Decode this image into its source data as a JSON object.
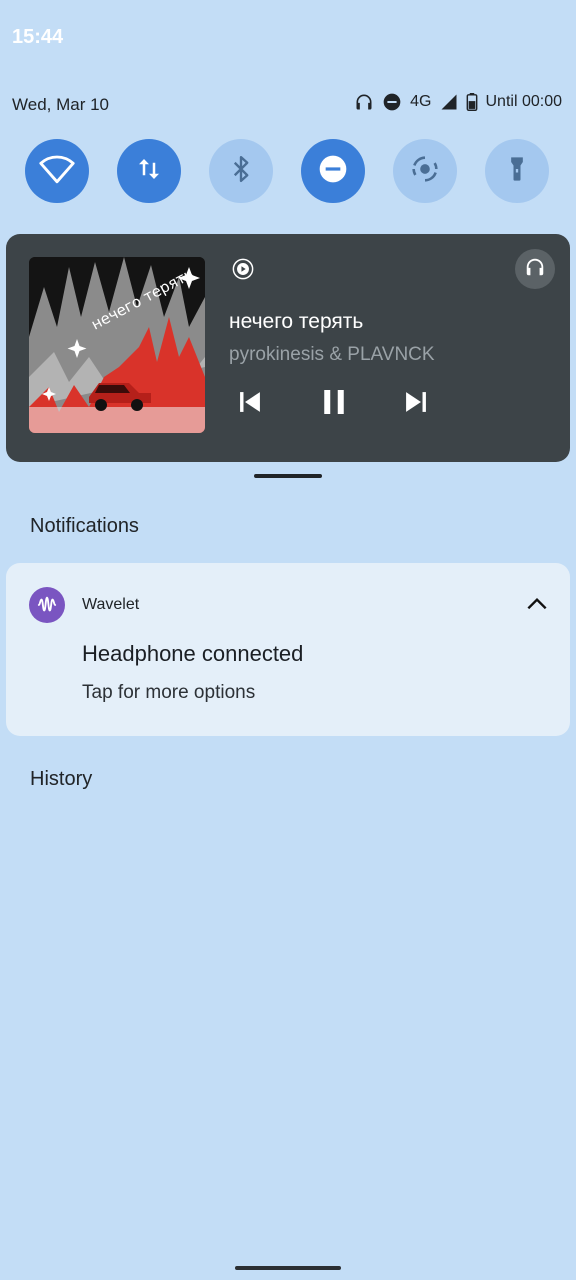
{
  "status_bar": {
    "time": "15:44",
    "date": "Wed, Mar 10",
    "network": "4G",
    "battery_text": "Until 00:00",
    "icons": [
      "headphones-icon",
      "do-not-disturb-icon",
      "signal-icon",
      "battery-icon"
    ]
  },
  "quick_settings": [
    {
      "name": "wifi",
      "icon": "wifi-icon",
      "state": "on"
    },
    {
      "name": "mobile-data",
      "icon": "data-transfer-icon",
      "state": "on"
    },
    {
      "name": "bluetooth",
      "icon": "bluetooth-icon",
      "state": "off"
    },
    {
      "name": "do-not-disturb",
      "icon": "do-not-disturb-icon",
      "state": "on"
    },
    {
      "name": "auto-rotate",
      "icon": "auto-rotate-icon",
      "state": "off"
    },
    {
      "name": "flashlight",
      "icon": "flashlight-icon",
      "state": "off"
    }
  ],
  "media": {
    "title": "нечего терять",
    "artist": "pyrokinesis & PLAVNCK",
    "album_art_text": "нечего терять",
    "colors": {
      "card": "#3d4448",
      "art_red": "#d9332a"
    }
  },
  "notifications": {
    "header": "Notifications",
    "items": [
      {
        "app": "Wavelet",
        "title": "Headphone connected",
        "text": "Tap for more options",
        "icon_color": "#7a55c1"
      }
    ]
  },
  "history": {
    "label": "History"
  },
  "colors": {
    "background": "#c3ddf6",
    "tile_on": "#3b7fd9",
    "tile_off": "#a4c8ef"
  }
}
